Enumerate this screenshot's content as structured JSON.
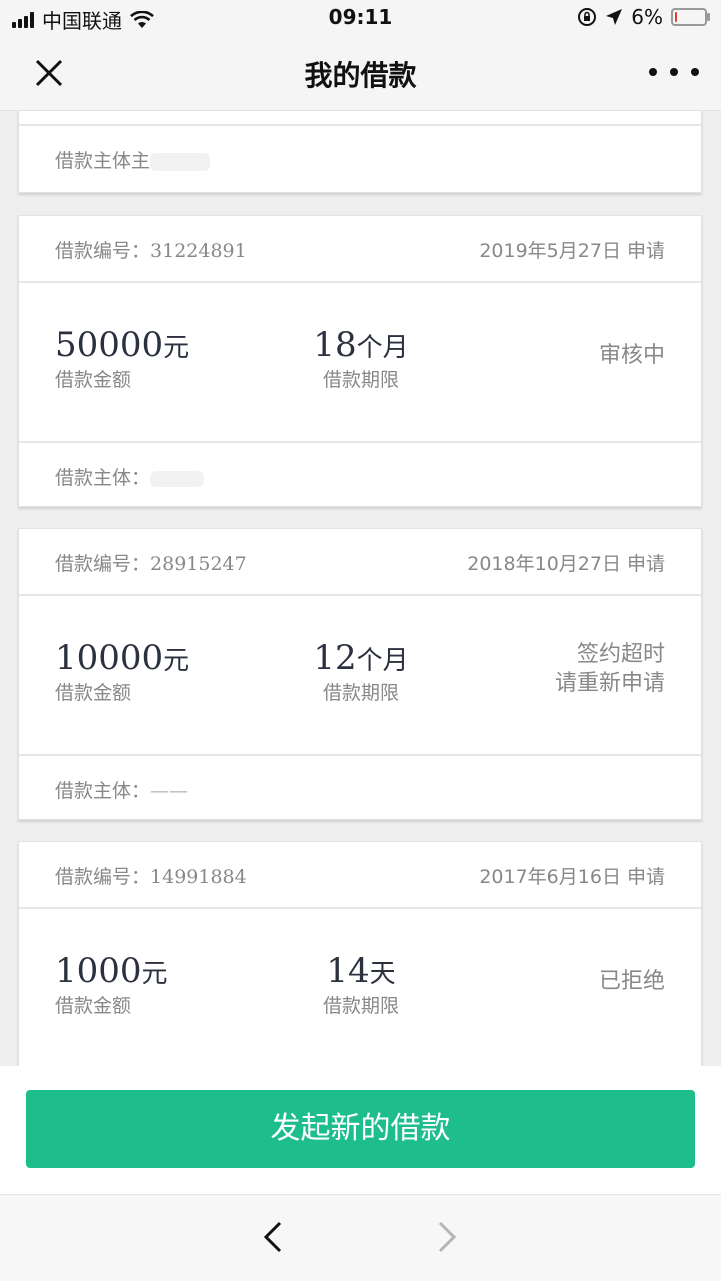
{
  "status_bar": {
    "carrier": "中国联通",
    "time": "09:11",
    "battery_text": "6%",
    "battery_level": 0.06,
    "battery_color": "#e53935"
  },
  "nav": {
    "title": "我的借款",
    "close_icon": "close-icon",
    "more_icon": "more-icon"
  },
  "top_card": {
    "subject_label": "借款主体主"
  },
  "loans": [
    {
      "id_label": "借款编号：",
      "id": "31224891",
      "date": "2019年5月27日 申请",
      "amount": "50000",
      "amount_unit": "元",
      "amount_label": "借款金额",
      "term": "18",
      "term_unit": "个月",
      "term_label": "借款期限",
      "status_line1": "审核中",
      "status_line2": "",
      "subject_label": "借款主体：",
      "subject_value": ""
    },
    {
      "id_label": "借款编号：",
      "id": "28915247",
      "date": "2018年10月27日 申请",
      "amount": "10000",
      "amount_unit": "元",
      "amount_label": "借款金额",
      "term": "12",
      "term_unit": "个月",
      "term_label": "借款期限",
      "status_line1": "签约超时",
      "status_line2": "请重新申请",
      "subject_label": "借款主体：",
      "subject_value": "——"
    },
    {
      "id_label": "借款编号：",
      "id": "14991884",
      "date": "2017年6月16日 申请",
      "amount": "1000",
      "amount_unit": "元",
      "amount_label": "借款金额",
      "term": "14",
      "term_unit": "天",
      "term_label": "借款期限",
      "status_line1": "已拒绝",
      "status_line2": ""
    }
  ],
  "primary_button": {
    "label": "发起新的借款",
    "color": "#1dbe8c"
  },
  "browser_nav": {
    "back_icon": "chevron-left-icon",
    "forward_icon": "chevron-right-icon"
  }
}
